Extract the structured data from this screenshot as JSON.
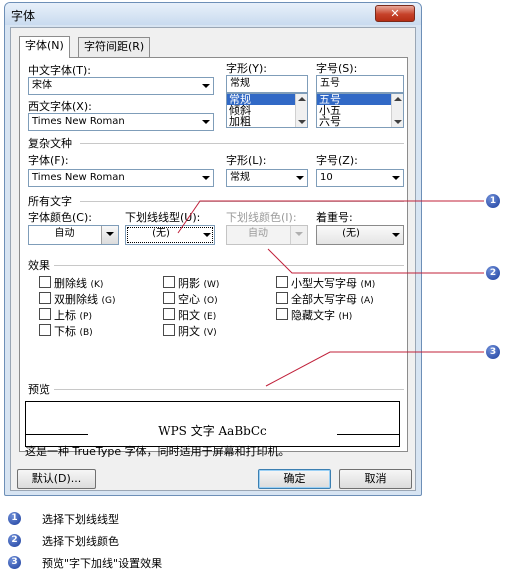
{
  "window": {
    "title": "字体",
    "close_label": "✕"
  },
  "tabs": [
    {
      "label": "字体(N)"
    },
    {
      "label": "字符间距(R)"
    }
  ],
  "chinese_font": {
    "label": "中文字体(T):",
    "value": "宋体"
  },
  "style": {
    "label": "字形(Y):",
    "value": "常规",
    "options": [
      "常规",
      "倾斜",
      "加粗"
    ]
  },
  "size": {
    "label": "字号(S):",
    "value": "五号",
    "options": [
      "五号",
      "小五",
      "六号"
    ]
  },
  "western_font": {
    "label": "西文字体(X):",
    "value": "Times New Roman"
  },
  "complex_section": "复杂文种",
  "complex_font": {
    "label": "字体(F):",
    "value": "Times New Roman"
  },
  "complex_style": {
    "label": "字形(L):",
    "value": "常规"
  },
  "complex_size": {
    "label": "字号(Z):",
    "value": "10"
  },
  "all_text_section": "所有文字",
  "font_color": {
    "label": "字体颜色(C):",
    "value": "自动"
  },
  "underline_type": {
    "label": "下划线线型(U):",
    "value": "(无)"
  },
  "underline_color": {
    "label": "下划线颜色(I):",
    "value": "自动"
  },
  "emphasis": {
    "label": "着重号:",
    "value": "(无)"
  },
  "effects_section": "效果",
  "effects": [
    {
      "label": "删除线",
      "key": "(K)"
    },
    {
      "label": "双删除线",
      "key": "(G)"
    },
    {
      "label": "上标",
      "key": "(P)"
    },
    {
      "label": "下标",
      "key": "(B)"
    },
    {
      "label": "阴影",
      "key": "(W)"
    },
    {
      "label": "空心",
      "key": "(O)"
    },
    {
      "label": "阳文",
      "key": "(E)"
    },
    {
      "label": "阴文",
      "key": "(V)"
    },
    {
      "label": "小型大写字母",
      "key": "(M)"
    },
    {
      "label": "全部大写字母",
      "key": "(A)"
    },
    {
      "label": "隐藏文字",
      "key": "(H)"
    }
  ],
  "preview_section": "预览",
  "preview_text": "WPS 文字  AaBbCc",
  "info_text": "这是一种 TrueType 字体，同时适用于屏幕和打印机。",
  "buttons": {
    "default": "默认(D)...",
    "ok": "确定",
    "cancel": "取消"
  },
  "callouts": [
    "1",
    "2",
    "3"
  ],
  "legend": [
    {
      "num": "1",
      "text": "选择下划线线型"
    },
    {
      "num": "2",
      "text": "选择下划线颜色"
    },
    {
      "num": "3",
      "text": "预览\"字下加线\"设置效果"
    }
  ]
}
